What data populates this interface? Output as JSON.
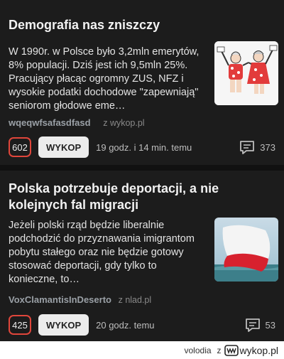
{
  "posts": [
    {
      "title": "Demografia nas zniszczy",
      "excerpt": "W 1990r. w Polsce było 3,2mln emerytów, 8% populacji. Dziś jest ich 9,5mln 25%. Pracujący płacąc ogromny ZUS, NFZ i wysokie podatki dochodowe \"zapewniają\" seniorom głodowe eme…",
      "author": "wqeqwfsafasdfasd",
      "source": "z wykop.pl",
      "votes": "602",
      "wykop_label": "WYKOP",
      "time": "19 godz. i 14 min. temu",
      "comments": "373",
      "thumbnail_icon": "dancing-seniors-illustration"
    },
    {
      "title": "Polska potrzebuje deportacji, a nie kolejnych fal migracji",
      "excerpt": "Jeżeli polski rząd będzie liberalnie podchodzić do przyznawania imigrantom pobytu stałego oraz nie będzie gotowy stosować deportacji, gdy tylko to konieczne, to…",
      "author": "VoxClamantisInDeserto",
      "source": "z nlad.pl",
      "votes": "425",
      "wykop_label": "WYKOP",
      "time": "20 godz. temu",
      "comments": "53",
      "thumbnail_icon": "polish-flag-sea-photo"
    }
  ],
  "footer": {
    "username": "volodia",
    "z": "z",
    "brand": "wykop.pl"
  },
  "colors": {
    "vote_border": "#e0463b",
    "card_bg": "#1c1c1c",
    "page_bg": "#111111"
  }
}
